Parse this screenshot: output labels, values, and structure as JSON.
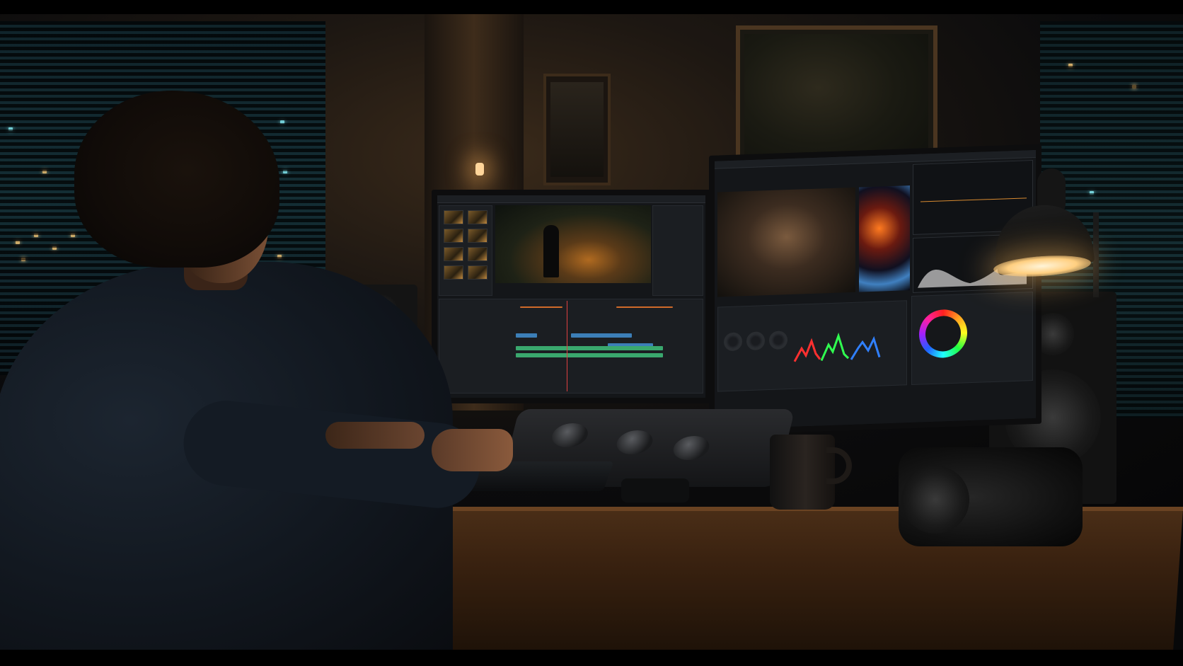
{
  "scene": {
    "description_tags": [
      "video-editor-workspace"
    ],
    "left_monitor": {
      "app_panels": [
        "media-bin",
        "program-viewer",
        "effects-panel",
        "timeline"
      ],
      "timeline_clip_colors": [
        "#3c7fb8",
        "#3aa86e",
        "#d06a2a"
      ]
    },
    "right_monitor": {
      "app_panels": [
        "viewer",
        "secondary-viewer",
        "scopes",
        "color-wheels",
        "histogram"
      ],
      "waveform_colors": [
        "#ff3030",
        "#30ff50",
        "#3080ff"
      ]
    },
    "accent_colors": {
      "lamp": "#ffcf80",
      "city_lights": "#e8b86a",
      "window_glow": "#7fe0e8"
    },
    "icons": [
      "color-wheel-icon",
      "trackball-icon"
    ]
  }
}
